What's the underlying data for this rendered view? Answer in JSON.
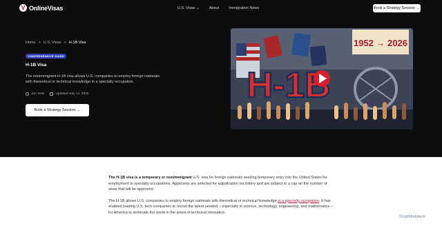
{
  "nav": {
    "logo_text": "OnlineVisas",
    "logo_glyph": "V",
    "links": [
      "U.S. Visas ⌄",
      "About",
      "Immigration News"
    ],
    "cta": "Book a Strategy Session →"
  },
  "hero": {
    "breadcrumbs": [
      "Home",
      "U.S. Visas",
      "H-1B Visa"
    ],
    "crumb_sep": ">",
    "badge": "COMPREHENSIVE GUIDE",
    "title": "H-1B Visa",
    "description": "The nonimmigrant H-1B visa allows U.S. companies to employ foreign nationals with theoretical or technical knowledge in a specialty occupation.",
    "author": "Jon Velie",
    "updated": "Updated July 14, 2026",
    "cta": "Book a Strategy Session →"
  },
  "thumbnail": {
    "years": "1952 → 2026",
    "big_text": "H-1B",
    "accent": "#d61f2c"
  },
  "content": {
    "p1_bold": "The H-1B visa is a temporary or nonimmigrant",
    "p1_rest": " U.S. visa for foreign nationals seeking temporary entry into the United States for employment in specialty occupations. Applicants are selected for adjudication via lottery and are subject to a cap on the number of visas that will be approved.",
    "p2_a": "The H-1B allows U.S. companies to employ foreign nationals with theoretical or technical knowledge ",
    "p2_link": "in a specialty occupation",
    "p2_b": ". It has enabled leading U.S. tech companies to recruit the talent needed – especially in science, technology, engineering, and mathematics – for America to dominate the world in the arena of technical innovation."
  },
  "watermark": "ScanMalware"
}
